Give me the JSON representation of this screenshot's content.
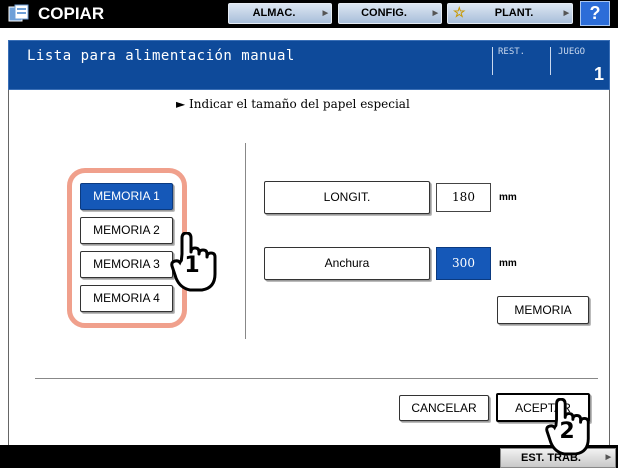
{
  "header": {
    "app_title": "COPIAR",
    "app_icon": "copier-icon",
    "buttons": [
      {
        "label": "ALMAC.",
        "icon": "chevron-right-icon"
      },
      {
        "label": "CONFIG.",
        "icon": "chevron-right-icon"
      },
      {
        "label": "PLANT.",
        "icon": "star-icon"
      }
    ],
    "help_label": "?"
  },
  "title_bar": {
    "screen_title": "Lista para alimentación manual",
    "rest_label": "REST.",
    "juego_label": "JUEGO",
    "juego_value": "1"
  },
  "main": {
    "instruction": "► Indicar el tamaño del papel especial",
    "memory_buttons": [
      {
        "label": "MEMORIA 1",
        "selected": true
      },
      {
        "label": "MEMORIA 2",
        "selected": false
      },
      {
        "label": "MEMORIA 3",
        "selected": false
      },
      {
        "label": "MEMORIA 4",
        "selected": false
      }
    ],
    "length": {
      "label": "LONGIT.",
      "value": "180",
      "unit": "mm"
    },
    "width": {
      "label": "Anchura",
      "value": "300",
      "unit": "mm"
    },
    "memory_save_label": "MEMORIA",
    "cancel_label": "CANCELAR",
    "accept_label": "ACEPTAR"
  },
  "annotations": {
    "callout_1": "1",
    "callout_2": "2",
    "highlight_color": "#f0a08c"
  },
  "footer": {
    "status_label": "EST. TRAB."
  },
  "colors": {
    "selected_blue": "#1558b8",
    "title_bar_blue": "#0e4a9a",
    "help_blue": "#2c6dd8"
  }
}
